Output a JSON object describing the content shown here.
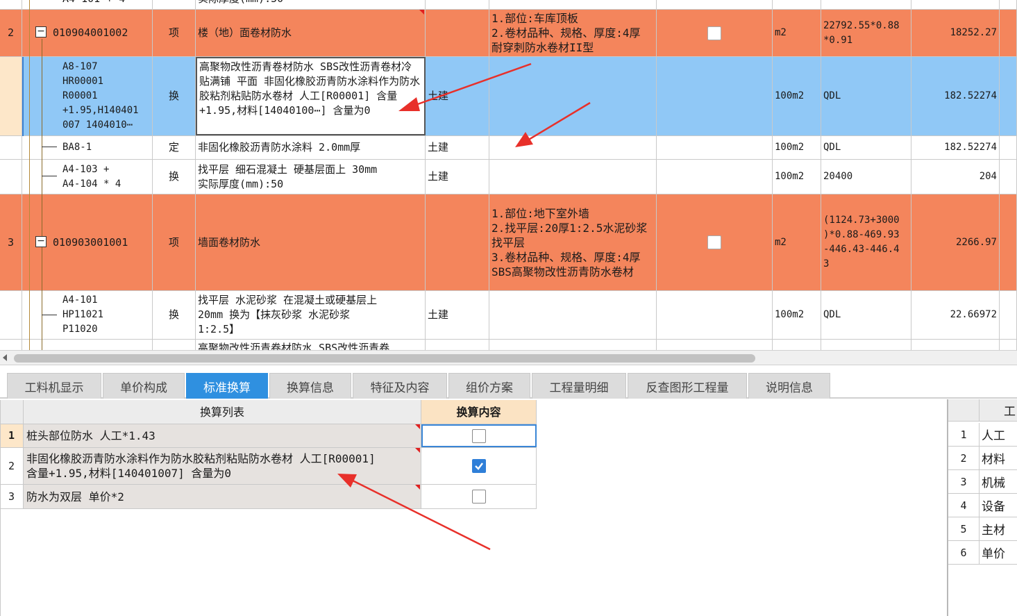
{
  "upper_grid": {
    "partial_top_row": {
      "code": "A4-101 + 4",
      "name": "实际厚度(mm):50"
    },
    "rows": [
      {
        "seq": "2",
        "code": "010904001002",
        "type": "项",
        "name": "楼（地）面卷材防水",
        "specialty": "",
        "features": "1.部位:车库顶板\n2.卷材品种、规格、厚度:4厚\n耐穿刺防水卷材II型",
        "unit": "m2",
        "expr": "22792.55*0.88\n*0.91",
        "qty": "18252.27"
      },
      {
        "seq": "",
        "code": "A8-107\nHR00001\nR00001\n+1.95,H140401\n007 1404010⋯",
        "type": "换",
        "name": "高聚物改性沥青卷材防水 SBS改性沥青卷材冷贴满铺 平面  非固化橡胶沥青防水涂料作为防水胶粘剂粘贴防水卷材 人工[R00001] 含量+1.95,材料[14040100⋯] 含量为0",
        "specialty": "土建",
        "features": "",
        "unit": "100m2",
        "expr": "QDL",
        "qty": "182.52274"
      },
      {
        "seq": "",
        "code": "BA8-1",
        "type": "定",
        "name": "非固化橡胶沥青防水涂料 2.0mm厚",
        "specialty": "土建",
        "features": "",
        "unit": "100m2",
        "expr": "QDL",
        "qty": "182.52274"
      },
      {
        "seq": "",
        "code": "A4-103 +\nA4-104 * 4",
        "type": "换",
        "name": "找平层 细石混凝土 硬基层面上 30mm\n实际厚度(mm):50",
        "specialty": "土建",
        "features": "",
        "unit": "100m2",
        "expr": "20400",
        "qty": "204"
      },
      {
        "seq": "3",
        "code": "010903001001",
        "type": "项",
        "name": "墙面卷材防水",
        "specialty": "",
        "features": "1.部位:地下室外墙\n2.找平层:20厚1:2.5水泥砂浆\n找平层\n3.卷材品种、规格、厚度:4厚\nSBS高聚物改性沥青防水卷材",
        "unit": "m2",
        "expr": "(1124.73+3000\n)*0.88-469.93\n-446.43-446.4\n3",
        "qty": "2266.97"
      },
      {
        "seq": "",
        "code": "A4-101\nHP11021\nP11020",
        "type": "换",
        "name": "找平层 水泥砂浆 在混凝土或硬基层上\n20mm  换为【抹灰砂浆 水泥砂浆\n1:2.5】",
        "specialty": "土建",
        "features": "",
        "unit": "100m2",
        "expr": "QDL",
        "qty": "22.66972"
      }
    ],
    "partial_bottom_row": {
      "name": "高聚物改性沥青卷材防水 SBS改性沥青卷"
    }
  },
  "tabs": [
    "工料机显示",
    "单价构成",
    "标准换算",
    "换算信息",
    "特征及内容",
    "组价方案",
    "工程量明细",
    "反查图形工程量",
    "说明信息"
  ],
  "active_tab": "标准换算",
  "conversion_table": {
    "col_list": "换算列表",
    "col_content": "换算内容",
    "rows": [
      {
        "num": "1",
        "text": "桩头部位防水 人工*1.43",
        "checked": false
      },
      {
        "num": "2",
        "text": "非固化橡胶沥青防水涂料作为防水胶粘剂粘贴防水卷材 人工[R00001]\n含量+1.95,材料[140401007] 含量为0",
        "checked": true
      },
      {
        "num": "3",
        "text": "防水为双层 单价*2",
        "checked": false
      }
    ]
  },
  "right_panel": {
    "header": "工",
    "rows": [
      {
        "num": "1",
        "label": "人工"
      },
      {
        "num": "2",
        "label": "材料"
      },
      {
        "num": "3",
        "label": "机械"
      },
      {
        "num": "4",
        "label": "设备"
      },
      {
        "num": "5",
        "label": "主材"
      },
      {
        "num": "6",
        "label": "单价"
      }
    ]
  },
  "colors": {
    "item_row": "#f4855c",
    "selected_row": "#90c8f6",
    "active_tab": "#2f90e0",
    "annotation_arrow": "#e8302a",
    "checkbox_checked": "#2f7fd8"
  }
}
